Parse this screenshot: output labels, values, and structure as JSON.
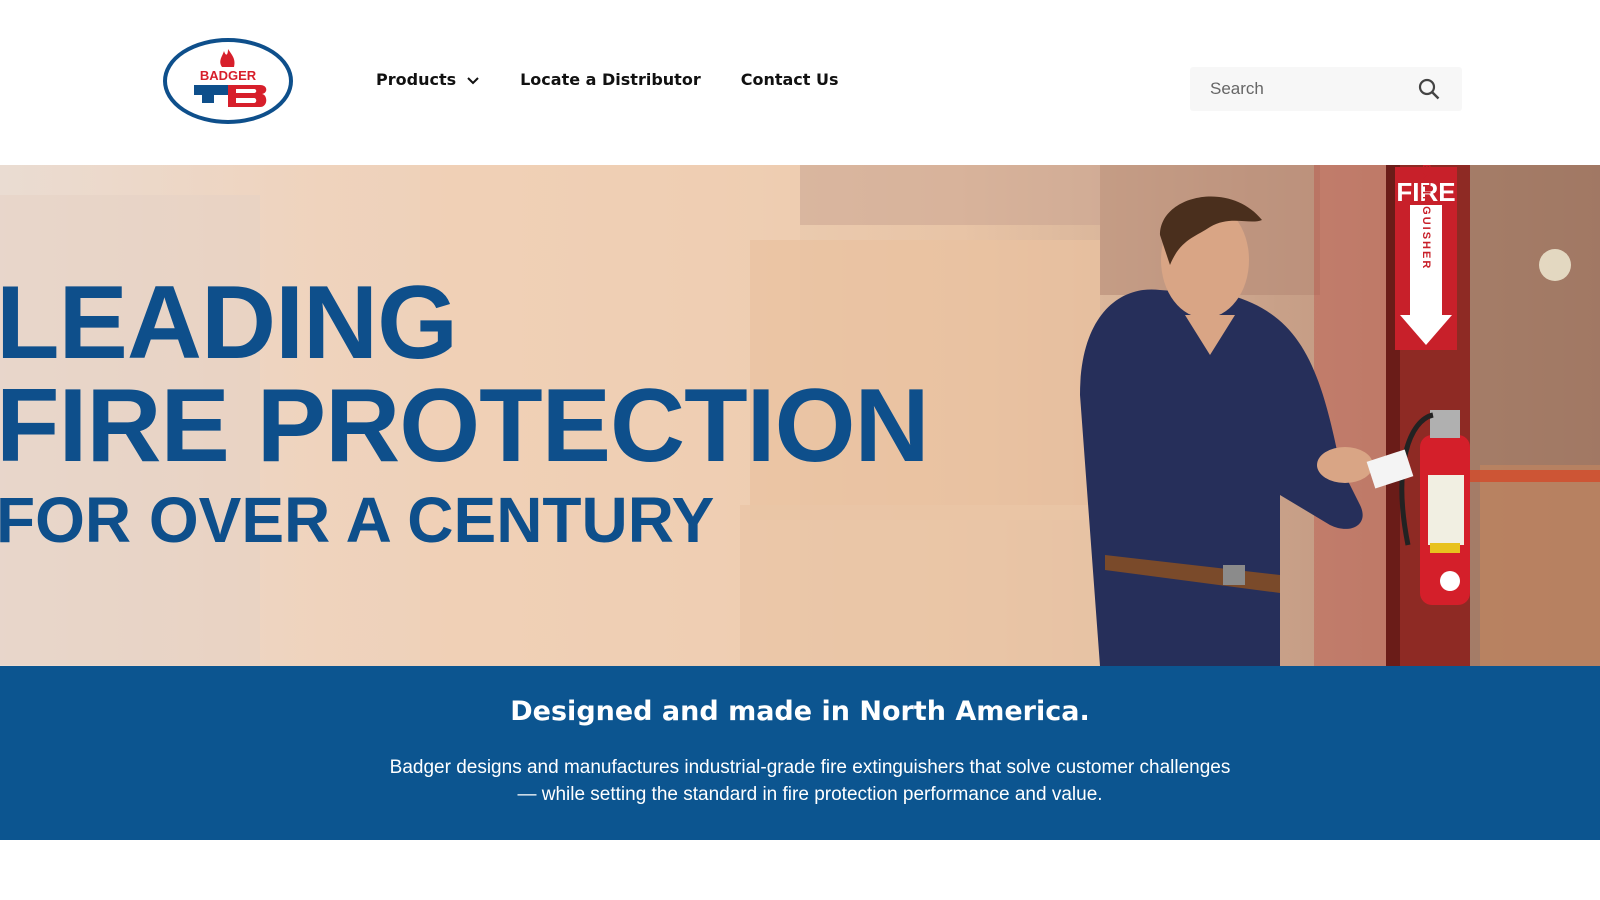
{
  "brand": {
    "logo_text": "BADGER",
    "primary_color": "#0e4f8b",
    "accent_color": "#d71f2b"
  },
  "nav": {
    "items": [
      {
        "label": "Products",
        "has_dropdown": true
      },
      {
        "label": "Locate a Distributor"
      },
      {
        "label": "Contact Us"
      }
    ]
  },
  "search": {
    "placeholder": "Search",
    "icon": "search-icon"
  },
  "hero": {
    "line1": "LEADING",
    "line2": "FIRE PROTECTION",
    "line3": "FOR OVER A CENTURY",
    "sign_line1": "FIRE",
    "sign_line2": "EXTINGUISHER"
  },
  "band": {
    "title": "Designed and made in North America.",
    "text_line1": "Badger designs and manufactures industrial-grade fire extinguishers that solve customer challenges",
    "text_line2": "— while setting the standard in fire protection performance and value."
  }
}
